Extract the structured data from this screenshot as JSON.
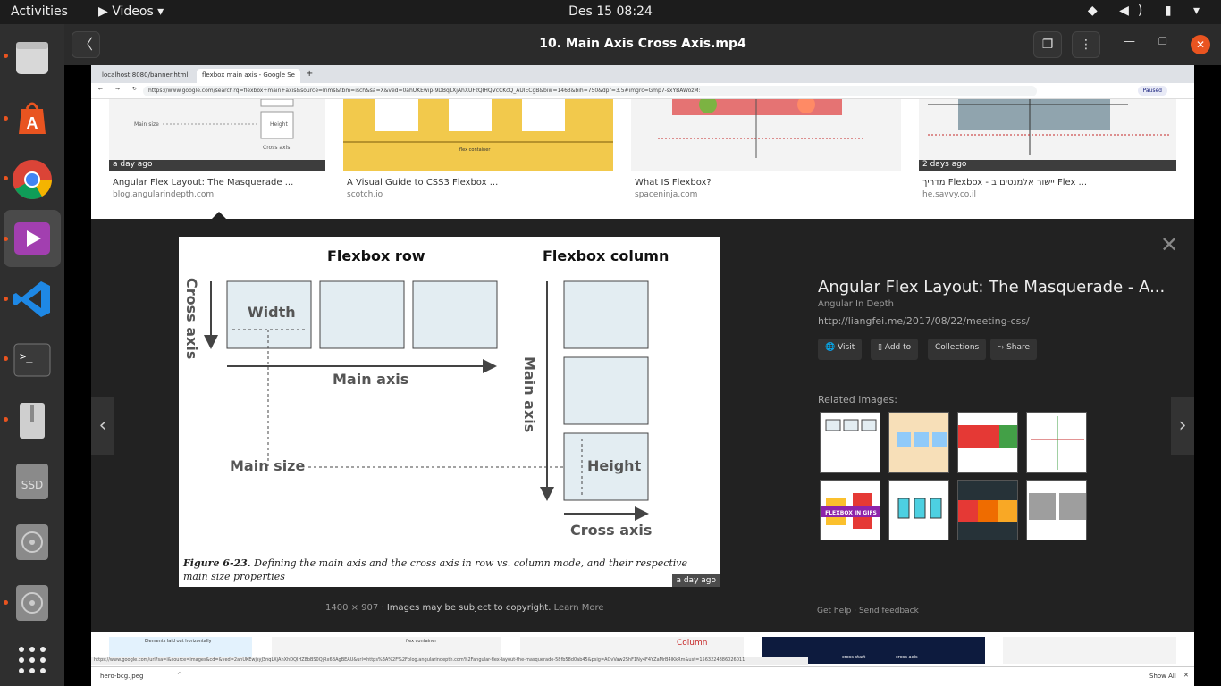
{
  "topbar": {
    "activities": "Activities",
    "app_menu": "▶ Videos ▾",
    "clock": "Des 15  08:24",
    "tray": "◆ ◀) ▮ ▾"
  },
  "window": {
    "title": "10. Main Axis  Cross Axis.mp4",
    "back_glyph": "〈",
    "screenshot_glyph": "❐",
    "menu_glyph": "⋮",
    "min_glyph": "—",
    "max_glyph": "❐",
    "close_glyph": "✕"
  },
  "browser": {
    "tabs": [
      "localhost:8080/banner.html",
      "flexbox main axis - Google Se"
    ],
    "url": "https://www.google.com/search?q=flexbox+main+axis&source=lnms&tbm=isch&sa=X&ved=0ahUKEwip-9DBqLXjAhXUFzQIHQVcCKcQ_AUIECgB&biw=1463&bih=750&dpr=3.5#imgrc=Gmp7-sxYBAWozM:",
    "paused": "Paused"
  },
  "results": [
    {
      "caption": "Angular Flex Layout: The Masquerade ...",
      "source": "blog.angularindepth.com",
      "ago": "a day ago"
    },
    {
      "caption": "A Visual Guide to CSS3 Flexbox ...",
      "source": "scotch.io",
      "ago": ""
    },
    {
      "caption": "What IS Flexbox?",
      "source": "spaceninja.com",
      "ago": ""
    },
    {
      "caption": "מדריך Flexbox - יישור אלמנטים ב Flex ...",
      "source": "he.savvy.co.il",
      "ago": "2 days ago"
    }
  ],
  "figure": {
    "row_title": "Flexbox row",
    "column_title": "Flexbox column",
    "width_label": "Width",
    "height_label": "Height",
    "main_axis": "Main axis",
    "cross_axis": "Cross axis",
    "main_size": "Main size",
    "caption_bold": "Figure 6-23.",
    "caption_text": "Defining the main axis and the cross axis in row vs. column mode, and their respective main size properties",
    "ago": "a day ago"
  },
  "side": {
    "title": "Angular Flex Layout: The Masquerade - A...",
    "subtitle": "Angular In Depth",
    "url": "http://liangfei.me/2017/08/22/meeting-css/",
    "actions": [
      "Visit",
      "Add to",
      "Collections",
      "Share"
    ],
    "related_label": "Related images:",
    "related_flexbox_gifs": "FLEXBOX IN GIFS",
    "close_glyph": "✕"
  },
  "meta": {
    "dims": "1400 × 907",
    "copyright": "Images may be subject to copyright.",
    "learn_more": "Learn More",
    "help": "Get help",
    "feedback": "Send feedback"
  },
  "status_url": "https://www.google.com/url?sa=i&source=images&cd=&ved=2ahUKEwjsyJ3nqLXjAhXhDQIHZ8bBS0QjRx6BAgBEAU&url=https%3A%2F%2Fblog.angularindepth.com%2Fangular-flex-layout-the-masquerade-58fb58d0ab45&psig=AOvVaw2ShF1Ny4F4YZaMrB4lKkRm&ust=1563224886026011",
  "download": {
    "file": "hero-bcg.jpeg",
    "show_all": "Show All"
  },
  "bottom_column_label": "Column",
  "bottom_row_texts": [
    "Elements laid out horizontally",
    "cross start",
    "cross axis",
    "flex container"
  ]
}
